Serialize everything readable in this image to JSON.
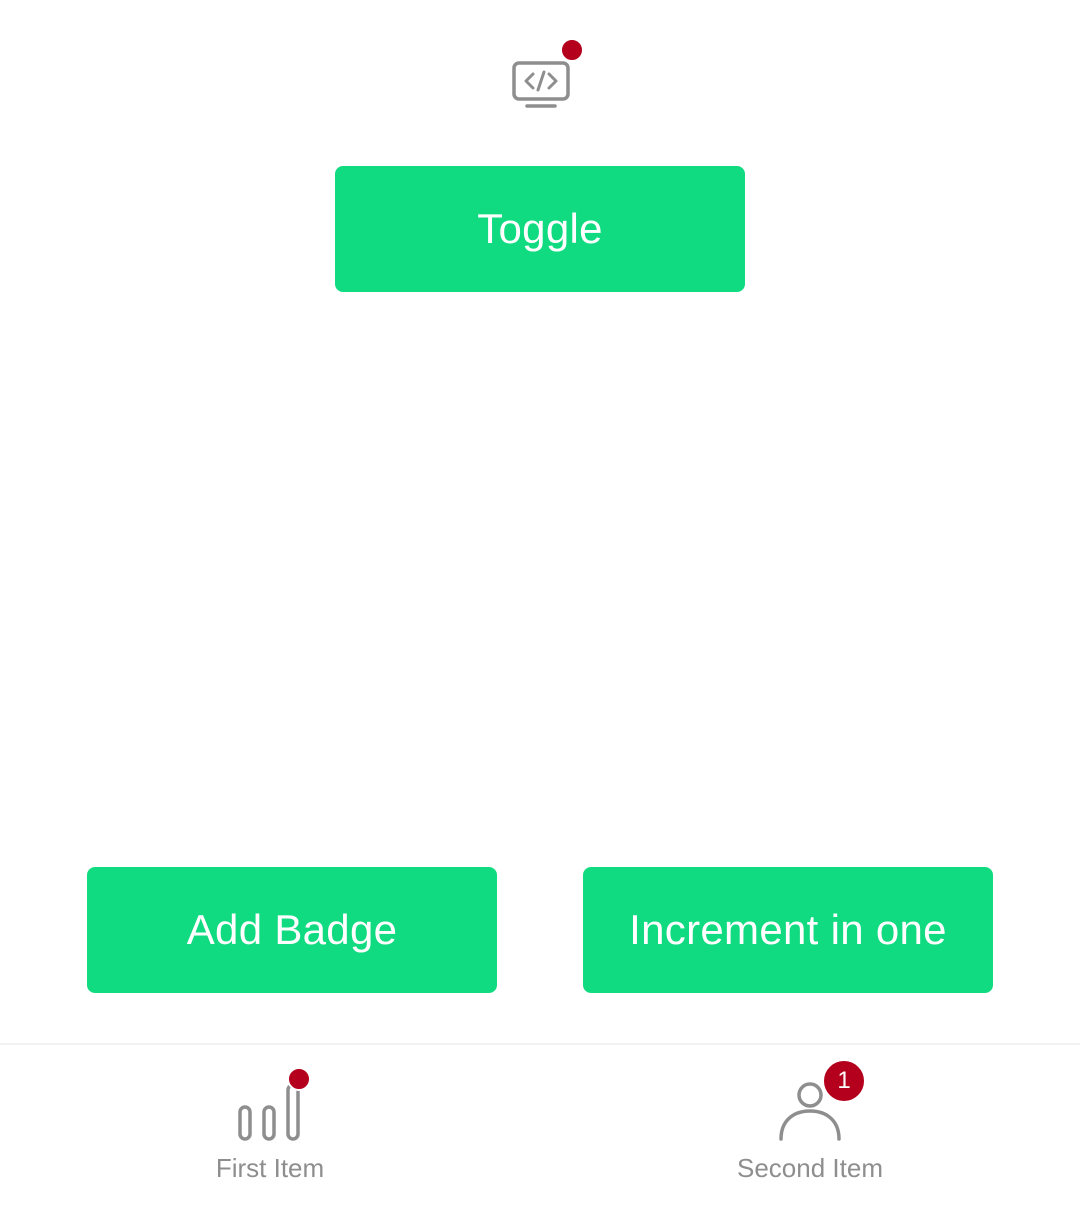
{
  "colors": {
    "accent": "#10db80",
    "badge": "#b4001c",
    "icon": "#8e8e8e",
    "label": "#8e8e8e"
  },
  "top": {
    "icon": "code-monitor-icon",
    "toggle_label": "Toggle"
  },
  "actions": {
    "add_badge_label": "Add Badge",
    "increment_label": "Increment in one"
  },
  "bottom_nav": {
    "items": [
      {
        "label": "First Item",
        "icon": "bar-chart-icon"
      },
      {
        "label": "Second Item",
        "icon": "user-icon",
        "badge_count": "1"
      }
    ]
  }
}
